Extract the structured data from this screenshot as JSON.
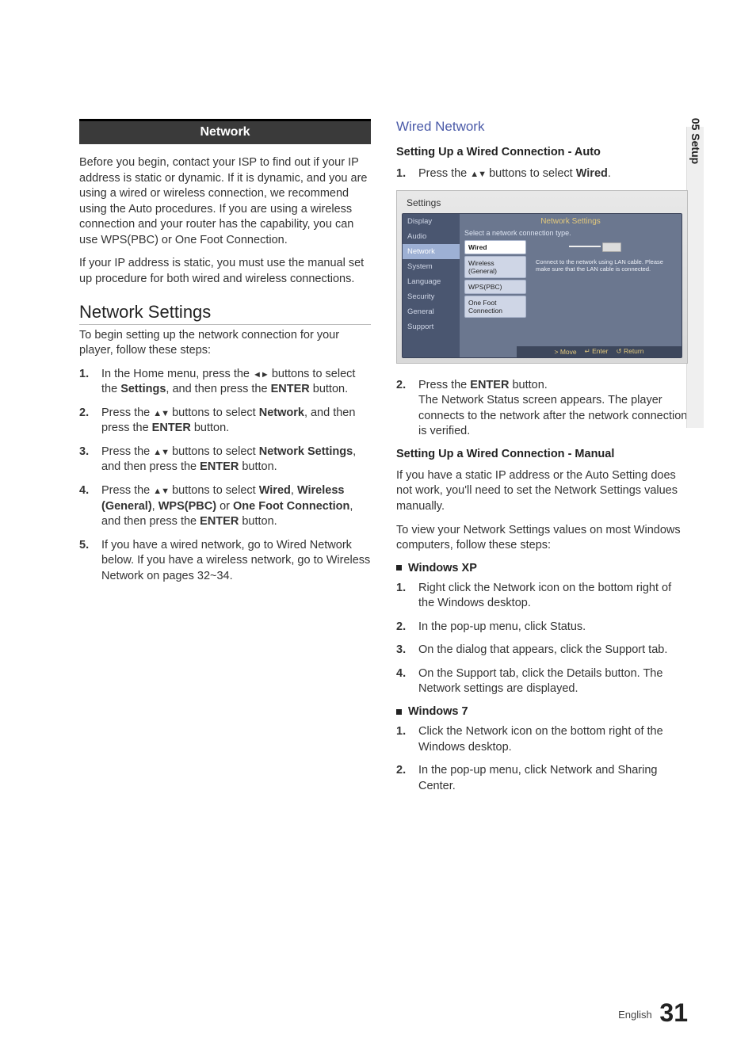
{
  "side_tab": "05  Setup",
  "left": {
    "banner": "Network",
    "para1_a": "Before you begin, contact your ISP to find out if your IP address is static or dynamic. If it is dynamic, and you are using a wired or wireless connection, we recommend using the Auto procedures. If you are using a wireless connection and your router has the capability, you can use WPS(PBC) or One Foot Connection.",
    "para1_b": "If your IP address is static, you must use the manual set up procedure for both wired and wireless connections.",
    "h2": "Network Settings",
    "para2": "To begin setting up the network connection for your player, follow these steps:",
    "steps": [
      {
        "n": "1.",
        "a": "In the Home menu, press the ",
        "icon": "lr",
        "b": " buttons to select the ",
        "bold1": "Settings",
        "c": ", and then press the ",
        "bold2": "ENTER",
        "d": " button."
      },
      {
        "n": "2.",
        "a": "Press the ",
        "icon": "ud",
        "b": " buttons to select ",
        "bold1": "Network",
        "c": ", and then press the ",
        "bold2": "ENTER",
        "d": " button."
      },
      {
        "n": "3.",
        "a": "Press the ",
        "icon": "ud",
        "b": " buttons to select ",
        "bold1": "Network Settings",
        "c": ", and then press the ",
        "bold2": "ENTER",
        "d": " button."
      },
      {
        "n": "4.",
        "a": "Press the ",
        "icon": "ud",
        "b": " buttons to select ",
        "bold1": "Wired",
        "c": ", ",
        "bold2": "Wireless (General)",
        "d": ", ",
        "bold3": "WPS(PBC)",
        "e": " or ",
        "bold4": "One Foot Connection",
        "f": ", and then press the ",
        "bold5": "ENTER",
        "g": " button."
      },
      {
        "n": "5.",
        "a": "If you have a wired network, go to Wired Network below. If you have a wireless network, go to Wireless Network on pages 32~34."
      }
    ]
  },
  "right": {
    "h3": "Wired Network",
    "h4a": "Setting Up a Wired Connection - Auto",
    "step1": {
      "n": "1.",
      "a": "Press the ",
      "icon": "ud",
      "b": " buttons to select ",
      "bold": "Wired",
      "c": "."
    },
    "osd": {
      "title": "Settings",
      "main_title": "Network Settings",
      "select_line": "Select a network connection type.",
      "side": [
        "Display",
        "Audio",
        "Network",
        "System",
        "Language",
        "Security",
        "General",
        "Support"
      ],
      "list": [
        "Wired",
        "Wireless (General)",
        "WPS(PBC)",
        "One Foot Connection"
      ],
      "note": "Connect to the network using LAN cable. Please make sure that the LAN cable is connected.",
      "foot_move": "> Move",
      "foot_enter": "↵ Enter",
      "foot_return": "↺ Return"
    },
    "step2": {
      "n": "2.",
      "a": "Press the ",
      "bold": "ENTER",
      "b": " button.\nThe Network Status screen appears. The player connects to the network after the network connection is verified."
    },
    "h4b": "Setting Up a Wired Connection - Manual",
    "para_m1": "If you have a static IP address or the Auto Setting does not work, you'll need to set the Network Settings values manually.",
    "para_m2": "To view your Network Settings values on most Windows computers, follow these steps:",
    "winxp": "Windows XP",
    "xp_steps": [
      {
        "n": "1.",
        "t": "Right click the Network icon on the bottom right of the Windows desktop."
      },
      {
        "n": "2.",
        "t": "In the pop-up menu, click Status."
      },
      {
        "n": "3.",
        "t": "On the dialog that appears, click the Support tab."
      },
      {
        "n": "4.",
        "t": "On the Support tab, click the Details button. The Network settings are displayed."
      }
    ],
    "win7": "Windows 7",
    "w7_steps": [
      {
        "n": "1.",
        "t": "Click the Network icon on the bottom right of the Windows desktop."
      },
      {
        "n": "2.",
        "t": "In the pop-up menu, click Network and Sharing Center."
      }
    ]
  },
  "footer": {
    "lang": "English",
    "page": "31"
  }
}
